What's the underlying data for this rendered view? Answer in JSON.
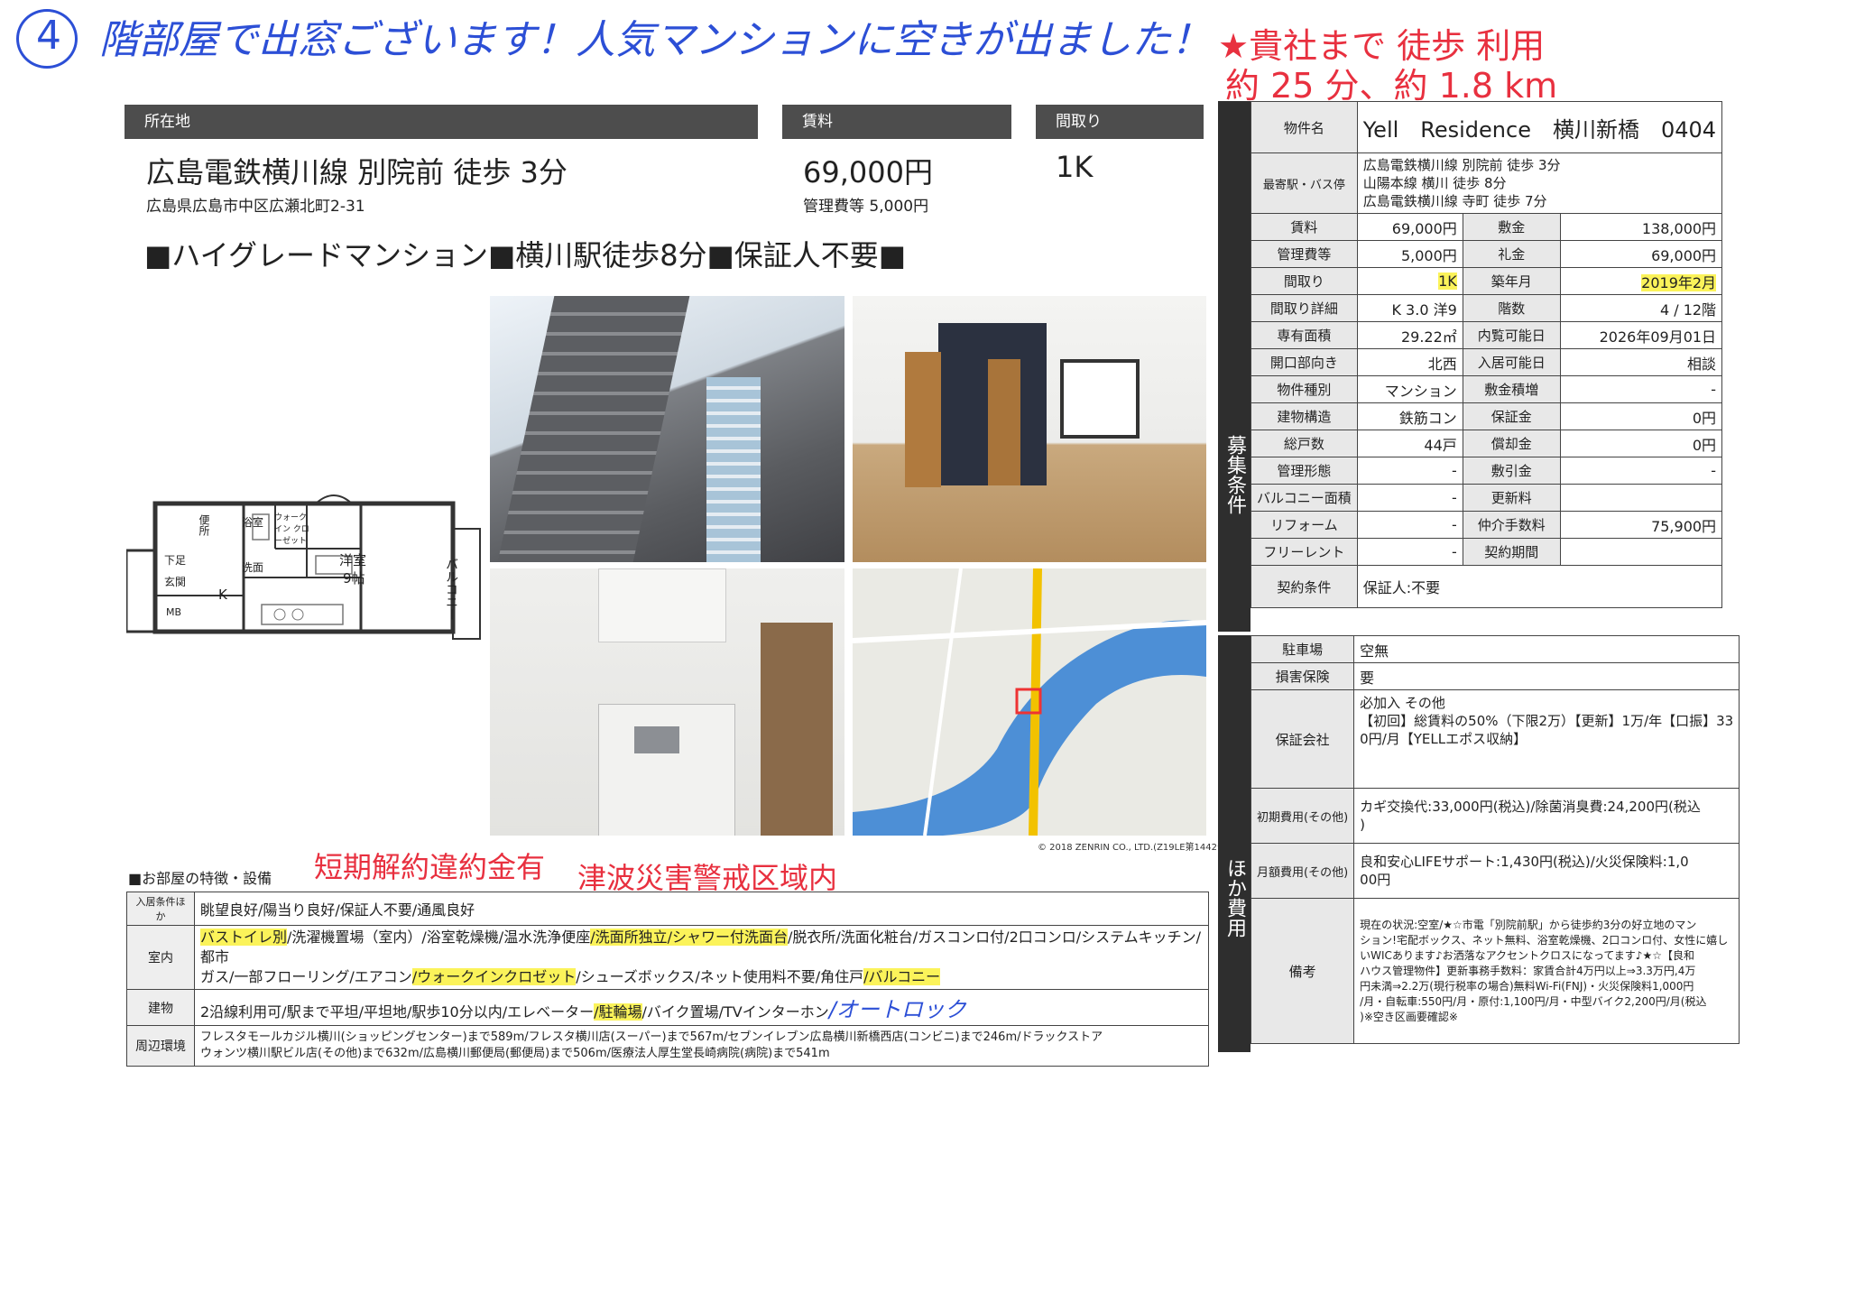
{
  "handwriting": {
    "circle_number": "4",
    "top_line": "階部屋で出窓ございます！人気マンションに空きが出ました！",
    "walk_line1": "★貴社まで 徒歩 利用",
    "walk_line2": "約 25 分、約 1.8 km",
    "note1": "短期解約違約金有",
    "note2": "津波災害警戒区域内",
    "auto_lock": "/オートロック"
  },
  "summary": {
    "location_header": "所在地",
    "rent_header": "賃料",
    "layout_header": "間取り",
    "station": "広島電鉄横川線 別院前 徒歩 3分",
    "address": "広島県広島市中区広瀬北町2-31",
    "rent": "69,000円",
    "mgmt_fee": "管理費等 5,000円",
    "layout": "1K",
    "catch": "■ハイグレードマンション■横川駅徒歩8分■保証人不要■"
  },
  "floorplan": {
    "bath": "浴室",
    "toilet": "便所",
    "wic": "ウォークイン クローゼット",
    "western": "洋室",
    "western_size": "9帖",
    "wash": "洗面",
    "shoes": "下足",
    "entrance": "玄関",
    "kitchen": "K",
    "mb": "MB",
    "balcony": "バルコニー"
  },
  "photos": {
    "map_credit": "© 2018 ZENRIN CO., LTD.(Z19LE第1442号)"
  },
  "property": {
    "name_label": "物件名",
    "name": "Yell　Residence　横川新橋　0404",
    "station_label": "最寄駅・バス停",
    "stations": [
      "広島電鉄横川線 別院前 徒歩 3分",
      "山陽本線 横川 徒歩 8分",
      "広島電鉄横川線 寺町 徒歩 7分"
    ],
    "side1": "募集条件",
    "rows": [
      {
        "k1": "賃料",
        "v1": "69,000円",
        "k2": "敷金",
        "v2": "138,000円"
      },
      {
        "k1": "管理費等",
        "v1": "5,000円",
        "k2": "礼金",
        "v2": "69,000円"
      },
      {
        "k1": "間取り",
        "v1": "1K",
        "k2": "築年月",
        "v2": "2019年2月"
      },
      {
        "k1": "間取り詳細",
        "v1": "K 3.0 洋9",
        "k2": "階数",
        "v2": "4 / 12階"
      },
      {
        "k1": "専有面積",
        "v1": "29.22㎡",
        "k2": "内覧可能日",
        "v2": "2026年09月01日"
      },
      {
        "k1": "開口部向き",
        "v1": "北西",
        "k2": "入居可能日",
        "v2": "相談"
      },
      {
        "k1": "物件種別",
        "v1": "マンション",
        "k2": "敷金積増",
        "v2": "-"
      },
      {
        "k1": "建物構造",
        "v1": "鉄筋コン",
        "k2": "保証金",
        "v2": "0円"
      },
      {
        "k1": "総戸数",
        "v1": "44戸",
        "k2": "償却金",
        "v2": "0円"
      },
      {
        "k1": "管理形態",
        "v1": "-",
        "k2": "敷引金",
        "v2": "-"
      },
      {
        "k1": "バルコニー面積",
        "v1": "-",
        "k2": "更新料",
        "v2": ""
      },
      {
        "k1": "リフォーム",
        "v1": "-",
        "k2": "仲介手数料",
        "v2": "75,900円"
      },
      {
        "k1": "フリーレント",
        "v1": "-",
        "k2": "契約期間",
        "v2": ""
      }
    ],
    "contract_label": "契約条件",
    "contract": "保証人:不要"
  },
  "other": {
    "side2": "ほか費用",
    "parking_label": "駐車場",
    "parking": "空無",
    "insurance_label": "損害保険",
    "insurance": "要",
    "guarantor_label": "保証会社",
    "guarantor_l1": "必加入 その他",
    "guarantor_l2": "【初回】総賃料の50%（下限2万）【更新】1万/年【口振】33",
    "guarantor_l3": "0円/月【YELLエポス収納】",
    "initial_label": "初期費用(その他)",
    "initial_l1": "カギ交換代:33,000円(税込)/除菌消臭費:24,200円(税込",
    "initial_l2": ")",
    "monthly_label": "月額費用(その他)",
    "monthly_l1": "良和安心LIFEサポート:1,430円(税込)/火災保険料:1,0",
    "monthly_l2": "00円",
    "notes_label": "備考",
    "notes": [
      "現在の状況:空室/★☆市電「別院前駅」から徒歩約3分の好立地のマン",
      "ション!宅配ボックス、ネット無料、浴室乾燥機、2口コンロ付、女性に嬉し",
      "いWICあります♪お洒落なアクセントクロスになってます♪★☆【良和",
      "ハウス管理物件】更新事務手数料：家賃合計4万円以上⇒3.3万円,4万",
      "円未満⇒2.2万(現行税率の場合)無料Wi-Fi(FNJ)・火災保険料1,000円",
      "/月・自転車:550円/月・原付:1,100円/月・中型バイク2,200円/月(税込",
      ")※空き区画要確認※"
    ]
  },
  "features": {
    "title": "■お部屋の特徴・設備",
    "cond_label": "入居条件ほか",
    "cond": "眺望良好/陽当り良好/保証人不要/通風良好",
    "room_label": "室内",
    "room_a": "バストイレ別",
    "room_b": "/洗濯機置場（室内）/浴室乾燥機/温水洗浄便座",
    "room_c": "/洗面所独立/シャワー付洗面台",
    "room_d": "/脱衣所/洗面化粧台/ガスコンロ付/2口コンロ/システムキッチン/都市",
    "room_e": "ガス/一部フローリング/エアコン",
    "room_f": "/ウォークインクロゼット",
    "room_g": "/シューズボックス/ネット使用料不要/角住戸",
    "room_h": "/バルコニー",
    "bldg_label": "建物",
    "bldg_a": "2沿線利用可/駅まで平坦/平坦地/駅歩10分以内/エレベーター",
    "bldg_b": "/駐輪場",
    "bldg_c": "/バイク置場/TVインターホン",
    "env_label": "周辺環境",
    "env_l1": "フレスタモールカジル横川(ショッピングセンター)まで589m/フレスタ横川店(スーパー)まで567m/セブンイレブン広島横川新橋西店(コンビニ)まで246m/ドラックストア",
    "env_l2": "ウォンツ横川駅ビル店(その他)まで632m/広島横川郵便局(郵便局)まで506m/医療法人厚生堂長崎病院(病院)まで541m"
  }
}
